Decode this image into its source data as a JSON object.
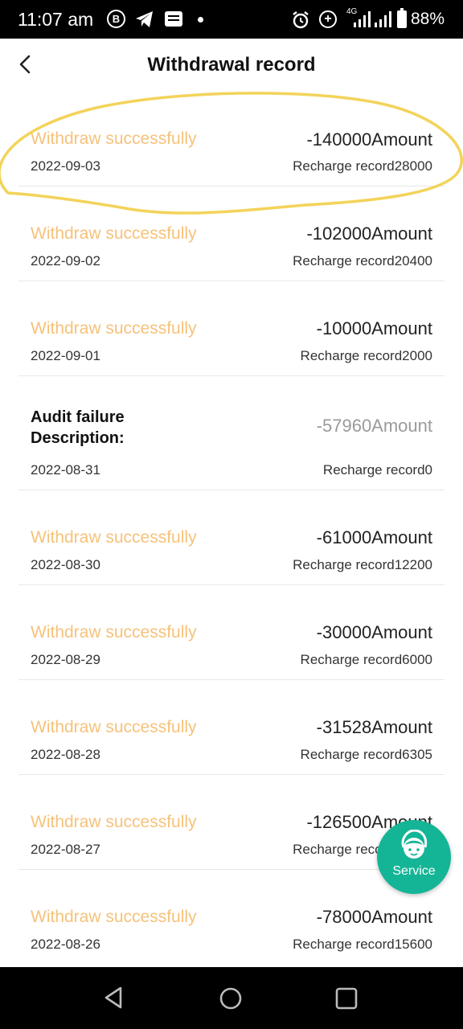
{
  "status_bar": {
    "time": "11:07 am",
    "b_icon_label": "B",
    "network": "4G",
    "battery": "88%"
  },
  "header": {
    "title": "Withdrawal record"
  },
  "records": [
    {
      "status": "Withdraw successfully",
      "amount": "-140000Amount",
      "date": "2022-09-03",
      "recharge": "Recharge record28000"
    },
    {
      "status": "Withdraw successfully",
      "amount": "-102000Amount",
      "date": "2022-09-02",
      "recharge": "Recharge record20400"
    },
    {
      "status": "Withdraw successfully",
      "amount": "-10000Amount",
      "date": "2022-09-01",
      "recharge": "Recharge record2000"
    },
    {
      "status": "Audit failure\nDescription:",
      "amount": "-57960Amount",
      "date": "2022-08-31",
      "recharge": "Recharge record0"
    },
    {
      "status": "Withdraw successfully",
      "amount": "-61000Amount",
      "date": "2022-08-30",
      "recharge": "Recharge record12200"
    },
    {
      "status": "Withdraw successfully",
      "amount": "-30000Amount",
      "date": "2022-08-29",
      "recharge": "Recharge record6000"
    },
    {
      "status": "Withdraw successfully",
      "amount": "-31528Amount",
      "date": "2022-08-28",
      "recharge": "Recharge record6305"
    },
    {
      "status": "Withdraw successfully",
      "amount": "-126500Amount",
      "date": "2022-08-27",
      "recharge": "Recharge record25300"
    },
    {
      "status": "Withdraw successfully",
      "amount": "-78000Amount",
      "date": "2022-08-26",
      "recharge": "Recharge record15600"
    }
  ],
  "service_button": {
    "label": "Service",
    "color": "#14b596"
  },
  "colors": {
    "success_status": "#f6c27a",
    "highlight_marker": "#f3d35a",
    "failed_amount": "#9a9a9a"
  }
}
